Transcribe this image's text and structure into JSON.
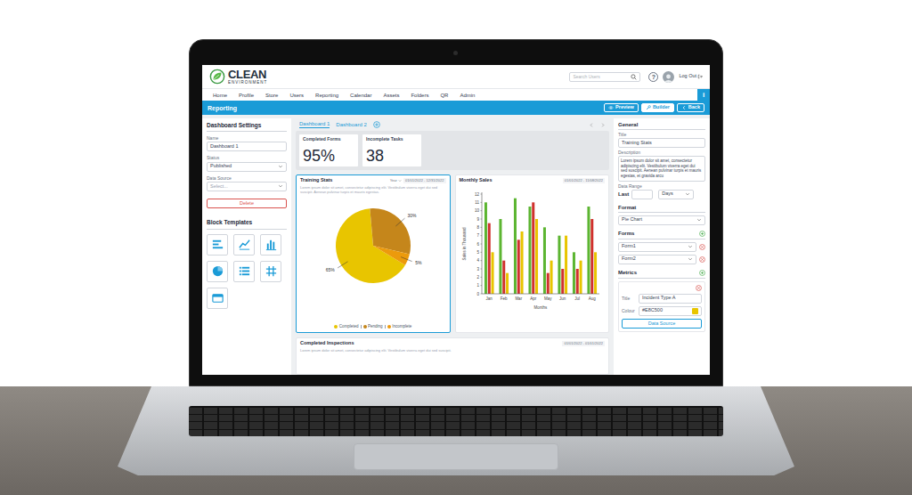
{
  "logo": {
    "name": "CLEAN",
    "subtitle": "ENVIRONMENT"
  },
  "header": {
    "search": {
      "placeholder": "Search Users"
    },
    "help": "?",
    "logout": "Log Out"
  },
  "nav": {
    "items": [
      "Home",
      "Profile",
      "Store",
      "Users",
      "Reporting",
      "Calendar",
      "Assets",
      "Folders",
      "QR",
      "Admin"
    ],
    "info": "i"
  },
  "toolbar": {
    "title": "Reporting",
    "buttons": [
      {
        "label": "Preview",
        "kind": "preview",
        "selected": false
      },
      {
        "label": "Builder",
        "kind": "builder",
        "selected": true
      },
      {
        "label": "Back",
        "kind": "back",
        "selected": false
      }
    ]
  },
  "settings": {
    "title": "Dashboard Settings",
    "fields": [
      {
        "label": "Name",
        "value": "Dashboard 1",
        "kind": "text",
        "placeholder": false
      },
      {
        "label": "Status",
        "value": "Published",
        "kind": "select",
        "placeholder": false
      },
      {
        "label": "Data Source",
        "value": "Select...",
        "kind": "select",
        "placeholder": true
      }
    ],
    "delete": "Delete"
  },
  "templates": {
    "title": "Block Templates",
    "items": [
      {
        "kind": "bar-h"
      },
      {
        "kind": "line"
      },
      {
        "kind": "bar"
      },
      {
        "kind": "pie"
      },
      {
        "kind": "list"
      },
      {
        "kind": "table"
      },
      {
        "kind": "card"
      }
    ]
  },
  "dashboard_tabs": [
    {
      "label": "Dashboard 1",
      "selected": true
    },
    {
      "label": "Dashboard 2",
      "selected": false
    }
  ],
  "stats": [
    {
      "label": "Completed Forms",
      "value": "95%"
    },
    {
      "label": "Incomplete Tasks",
      "value": "38"
    }
  ],
  "training": {
    "title": "Training Stats",
    "period": "Year",
    "date": "01/01/2022 - 12/31/2022",
    "selected": true,
    "description": "Lorem ipsum dolor sit amet, consectetur adipiscing elit. Vestibulum viverra eget dui sed suscipit. Aenean pulvinar turpis et mauris egestas.",
    "slices": [
      {
        "label": "Completed",
        "value": 65,
        "text": "65%",
        "color": "#e8c500"
      },
      {
        "label": "Pending",
        "value": 30,
        "text": "30%",
        "color": "#c5861b"
      },
      {
        "label": "Incomplete",
        "value": 5,
        "text": "5%",
        "color": "#ec9a0c"
      }
    ]
  },
  "monthly": {
    "title": "Monthly Sales",
    "date": "01/01/2022 - 11/08/2022",
    "y_label": "Sales in Thousand",
    "x_label": "Months",
    "y_ticks": [
      "0",
      "1",
      "2",
      "3",
      "4",
      "5",
      "6",
      "7",
      "8",
      "9",
      "10",
      "11",
      "12"
    ],
    "months": [
      "Jan",
      "Feb",
      "Mar",
      "Apr",
      "May",
      "Jun",
      "Jul",
      "Aug"
    ],
    "series": [
      {
        "color": "#5cb531",
        "values": [
          11,
          9,
          11.5,
          10.5,
          8,
          7,
          5,
          10.5
        ]
      },
      {
        "color": "#d0312d",
        "values": [
          8.5,
          4,
          6.5,
          11,
          2.5,
          3,
          3,
          9
        ]
      },
      {
        "color": "#e8c500",
        "values": [
          5,
          2.5,
          7.5,
          9,
          4,
          7,
          4,
          5
        ]
      }
    ]
  },
  "inspections": {
    "title": "Completed Inspections",
    "date": "01/01/2022 - 01/01/2022",
    "description": "Lorem ipsum dolor sit amet, consectetur adipiscing elit. Vestibulum viverra eget dui sed suscipit."
  },
  "properties": {
    "general": "General",
    "title_label": "Title",
    "title_value": "Training Stats",
    "description_label": "Description",
    "description": "Lorem ipsum dolor sit amet, consectetur adipiscing elit. Vestibulum viverra eget dui sed suscipit. Aenean pulvinar turpis et mauris egestas, et gravida arcu",
    "range_label": "Data Range",
    "range_prefix": "Last",
    "range_unit": "Days",
    "format_label": "Format",
    "format": "Pie Chart",
    "forms_label": "Forms",
    "forms": [
      "Form1",
      "Form2"
    ],
    "metrics_label": "Metrics",
    "metric": {
      "title_label": "Title",
      "title": "Incident Type A",
      "colour_label": "Colour",
      "colour": "#E8C500",
      "data_source": "Data Source"
    }
  }
}
